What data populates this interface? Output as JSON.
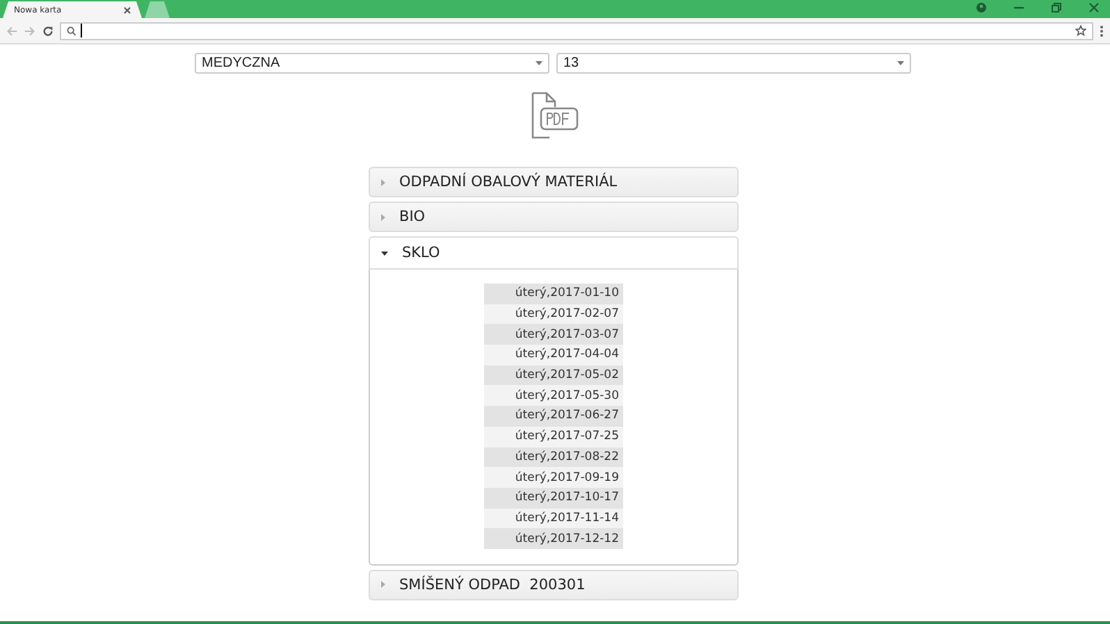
{
  "browser": {
    "tabs": [
      {
        "title": "Nowa karta",
        "selected": true
      }
    ]
  },
  "selects": [
    {
      "value": "MEDYCZNA"
    },
    {
      "value": "13"
    }
  ],
  "sections": [
    {
      "title": "ODPADNÍ OBALOVÝ MATERIÁL",
      "expanded": false
    },
    {
      "title": "BIO",
      "expanded": false
    },
    {
      "title": "SKLO",
      "expanded": true,
      "dates": [
        "úterý,2017-01-10",
        "úterý,2017-02-07",
        "úterý,2017-03-07",
        "úterý,2017-04-04",
        "úterý,2017-05-02",
        "úterý,2017-05-30",
        "úterý,2017-06-27",
        "úterý,2017-07-25",
        "úterý,2017-08-22",
        "úterý,2017-09-19",
        "úterý,2017-10-17",
        "úterý,2017-11-14",
        "úterý,2017-12-12"
      ]
    },
    {
      "title": "SMÍŠENÝ ODPAD  200301",
      "expanded": false
    }
  ]
}
